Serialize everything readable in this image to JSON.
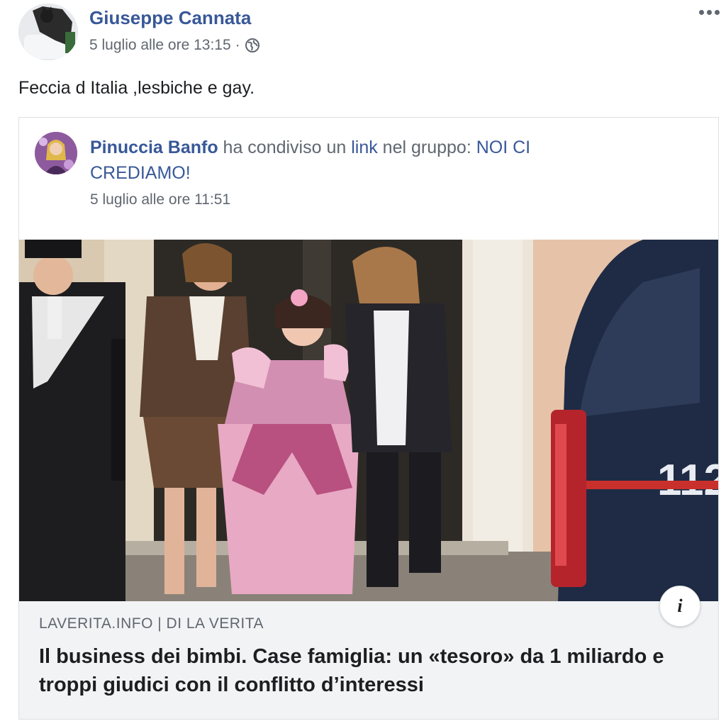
{
  "post": {
    "author": "Giuseppe Cannata",
    "timestamp": "5 luglio alle ore 13:15",
    "separator": "·",
    "privacy_icon": "globe-icon",
    "more_icon": "more-options-icon",
    "text": "Feccia d Italia ,lesbiche e gay."
  },
  "shared": {
    "author": "Pinuccia Banfo",
    "action_prefix": " ha condiviso un ",
    "action_link": "link",
    "action_middle": " nel gruppo: ",
    "group": "NOI CI CREDIAMO!",
    "timestamp": "5 luglio alle ore 11:51",
    "link_preview": {
      "info_icon": "info-icon",
      "info_label": "i",
      "source": "LAVERITA.INFO | DI LA VERITA",
      "headline": "Il business dei bimbi. Case famiglia: un «tesoro» da 1 miliardo e troppi giudici con il conflitto d’interessi",
      "image_text": "112"
    }
  },
  "colors": {
    "link_blue": "#385898",
    "meta_gray": "#606770",
    "caption_bg": "#f2f3f5"
  }
}
